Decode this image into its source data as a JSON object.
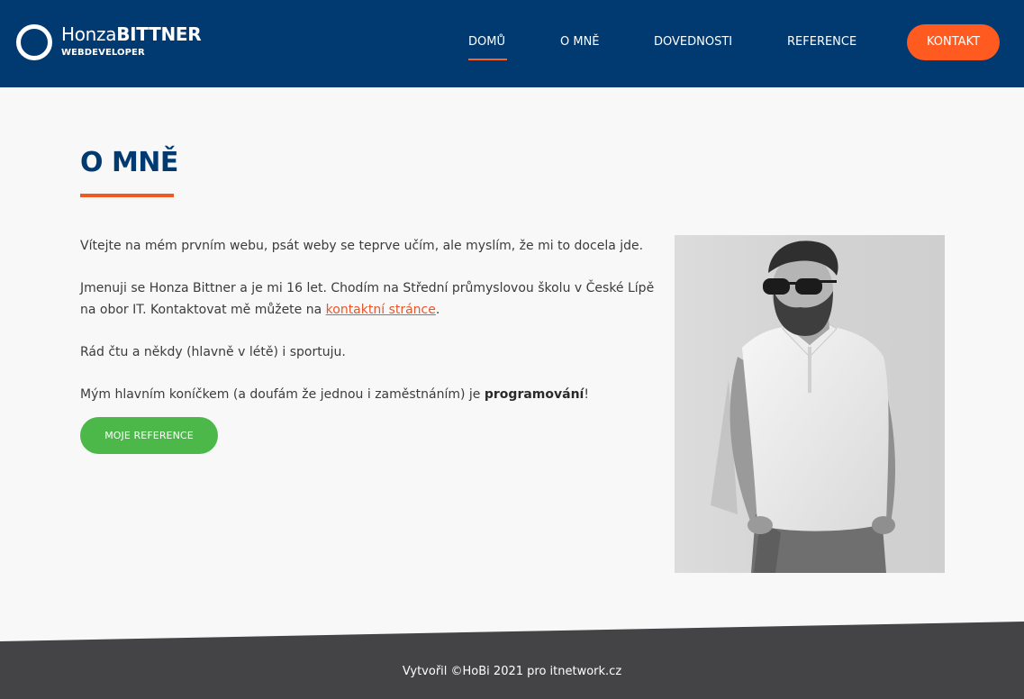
{
  "header": {
    "logo": {
      "first_name": "Honza",
      "last_name": "BITTNER",
      "subtitle": "WEBDEVELOPER"
    },
    "nav": [
      {
        "label": "DOMŮ",
        "active": true
      },
      {
        "label": "O MNĚ",
        "active": false
      },
      {
        "label": "DOVEDNOSTI",
        "active": false
      },
      {
        "label": "REFERENCE",
        "active": false
      }
    ],
    "contact_button": "KONTAKT"
  },
  "main": {
    "title": "O MNĚ",
    "paragraphs": {
      "p1": "Vítejte na mém prvním webu, psát weby se teprve učím, ale myslím, že mi to docela jde.",
      "p2_before": "Jmenuji se Honza Bittner a je mi 16 let. Chodím na Střední průmyslovou školu v České Lípě na obor IT. Kontaktovat mě můžete na ",
      "p2_link": "kontaktní stránce",
      "p2_after": ".",
      "p3": "Rád čtu a někdy (hlavně v létě) i sportuju.",
      "p4_before": "Mým hlavním koníčkem (a doufám že jednou i zaměstnáním) je ",
      "p4_bold": "programování",
      "p4_after": "!"
    },
    "reference_button": "MOJE REFERENCE"
  },
  "footer": {
    "text": "Vytvořil ©HoBi 2021 pro itnetwork.cz"
  },
  "colors": {
    "header_bg": "#003a70",
    "accent_orange": "#ff5a1f",
    "button_green": "#4cb84a",
    "footer_bg": "#444446"
  }
}
